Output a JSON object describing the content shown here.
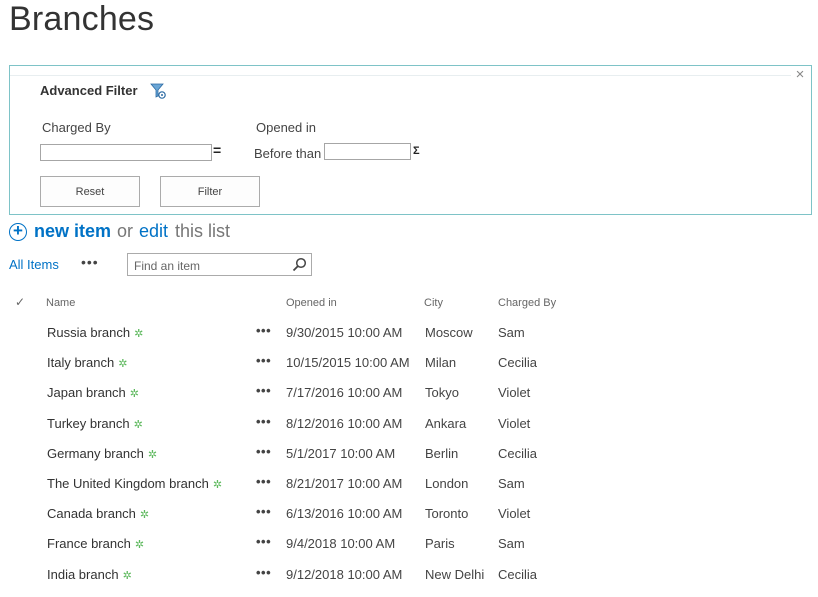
{
  "page": {
    "title": "Branches"
  },
  "filter": {
    "title": "Advanced Filter",
    "close_glyph": "×",
    "charged_by_label": "Charged By",
    "charged_by_value": "",
    "charged_by_operator": "=",
    "opened_in_label": "Opened in",
    "opened_in_operator_label": "Before than",
    "opened_in_value": "",
    "opened_in_operator_icon": "Σ",
    "reset_label": "Reset",
    "filter_label": "Filter"
  },
  "actions": {
    "plus_glyph": "+",
    "new_item": "new item",
    "or": "or",
    "edit": "edit",
    "this_list": "this list"
  },
  "view": {
    "all_items": "All Items",
    "more": "•••",
    "search_placeholder": "Find an item"
  },
  "list": {
    "columns": {
      "check": "✓",
      "name": "Name",
      "opened_in": "Opened in",
      "city": "City",
      "charged_by": "Charged By"
    },
    "new_badge": "✲",
    "row_menu": "•••",
    "rows": [
      {
        "name": "Russia branch",
        "opened_in": "9/30/2015 10:00 AM",
        "city": "Moscow",
        "charged_by": "Sam"
      },
      {
        "name": "Italy branch",
        "opened_in": "10/15/2015 10:00 AM",
        "city": "Milan",
        "charged_by": "Cecilia"
      },
      {
        "name": "Japan branch",
        "opened_in": "7/17/2016 10:00 AM",
        "city": "Tokyo",
        "charged_by": "Violet"
      },
      {
        "name": "Turkey branch",
        "opened_in": "8/12/2016 10:00 AM",
        "city": "Ankara",
        "charged_by": "Violet"
      },
      {
        "name": "Germany branch",
        "opened_in": "5/1/2017 10:00 AM",
        "city": "Berlin",
        "charged_by": "Cecilia"
      },
      {
        "name": "The United Kingdom branch",
        "opened_in": "8/21/2017 10:00 AM",
        "city": "London",
        "charged_by": "Sam"
      },
      {
        "name": "Canada branch",
        "opened_in": "6/13/2016 10:00 AM",
        "city": "Toronto",
        "charged_by": "Violet"
      },
      {
        "name": "France branch",
        "opened_in": "9/4/2018 10:00 AM",
        "city": "Paris",
        "charged_by": "Sam"
      },
      {
        "name": "India branch",
        "opened_in": "9/12/2018 10:00 AM",
        "city": "New Delhi",
        "charged_by": "Cecilia"
      }
    ]
  },
  "colors": {
    "link": "#0072c6",
    "panel_border": "#7ec3c7",
    "new_badge": "#5cb85c"
  }
}
